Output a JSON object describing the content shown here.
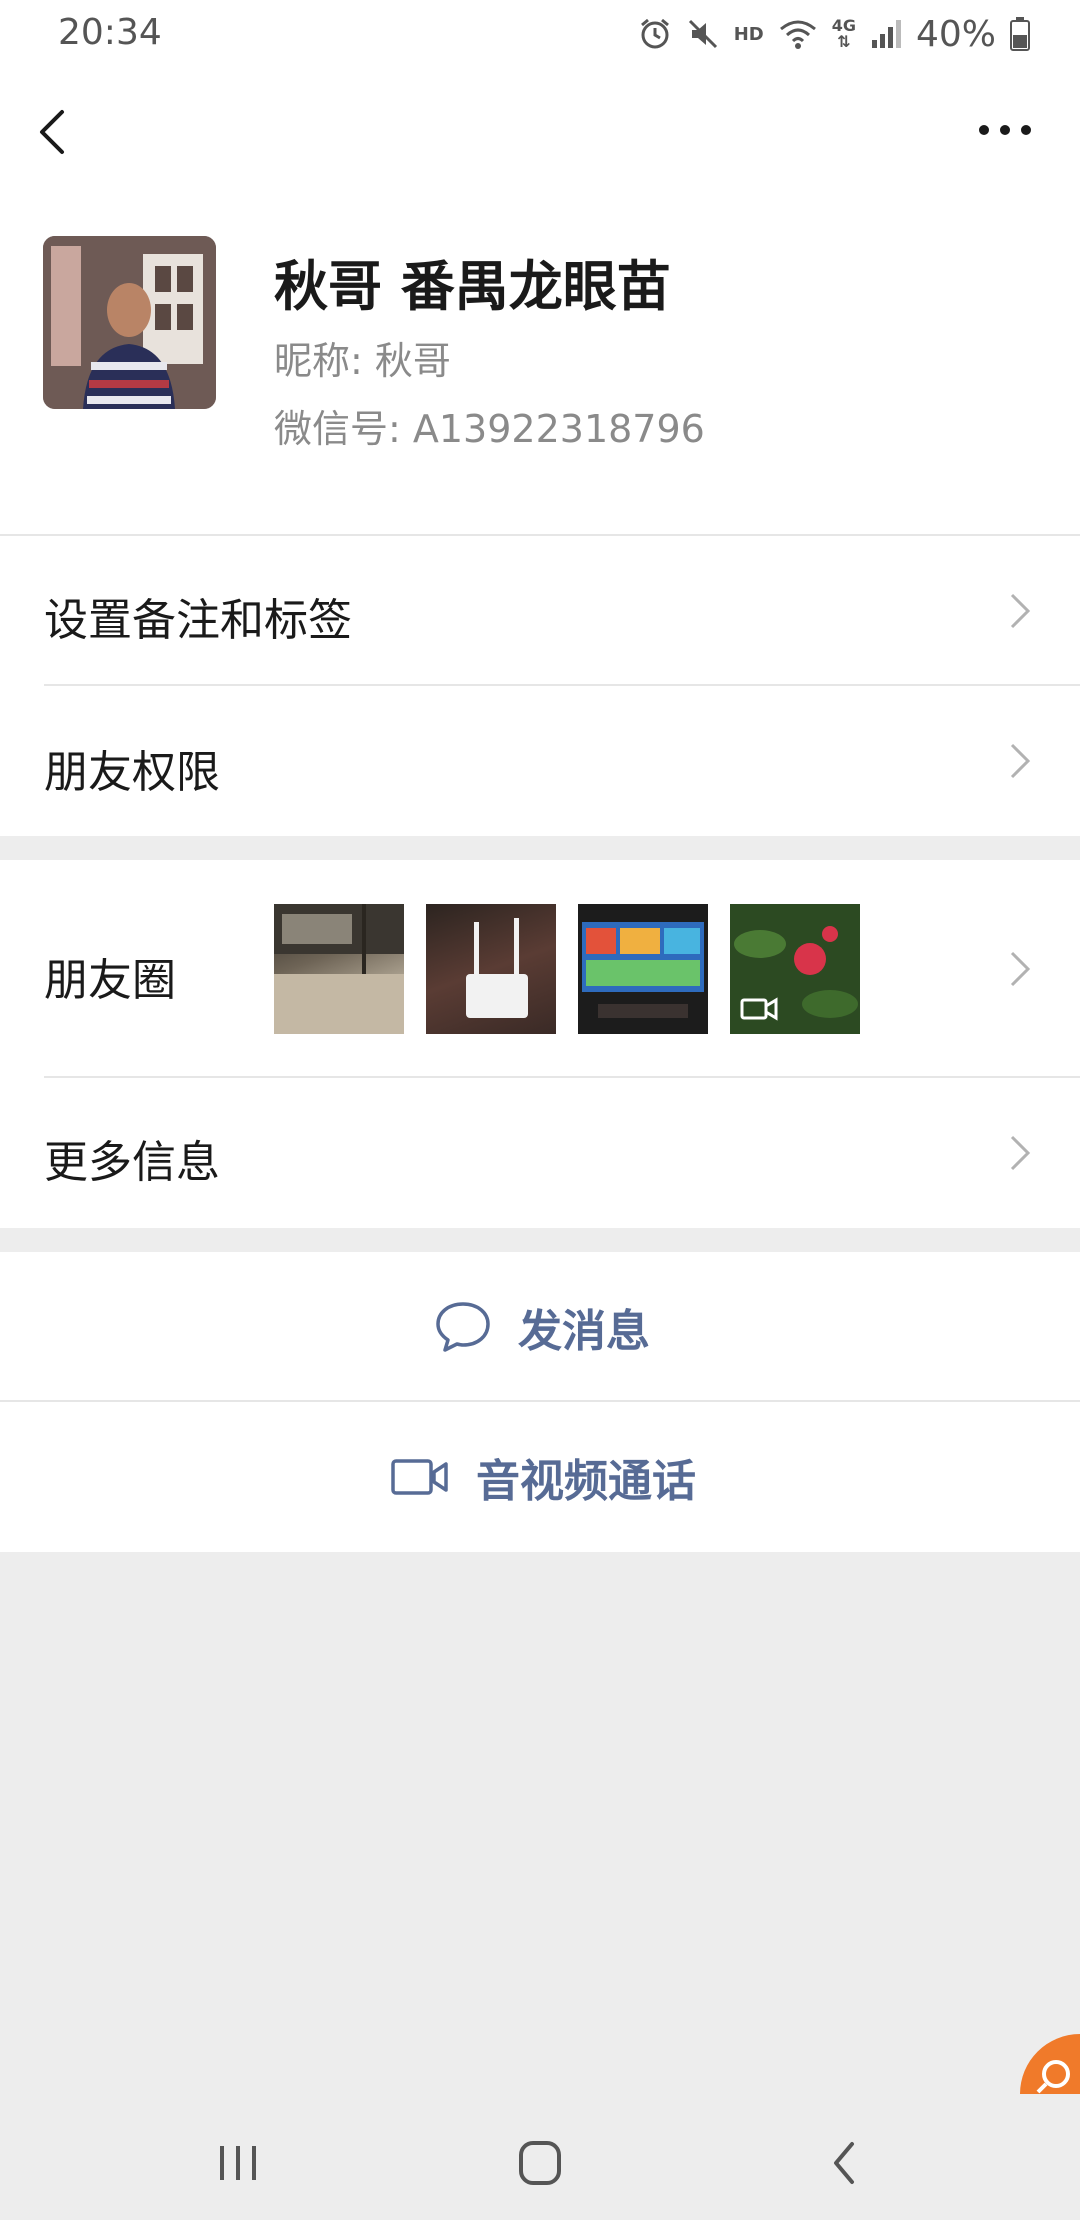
{
  "status_bar": {
    "time": "20:34",
    "hd": "HD",
    "network": "4G",
    "battery": "40%"
  },
  "profile": {
    "display_name": "秋哥 番禺龙眼苗",
    "nickname": "昵称:  秋哥",
    "wechat_id": "微信号:  A13922318796"
  },
  "list": {
    "remark_tags": "设置备注和标签",
    "friend_permissions": "朋友权限",
    "moments": "朋友圈",
    "more_info": "更多信息"
  },
  "actions": {
    "send_message": "发消息",
    "video_call": "音视频通话"
  },
  "colors": {
    "accent": "#576b95",
    "background": "#ededed",
    "card": "#ffffff",
    "float_bubble": "#f07a2a"
  }
}
